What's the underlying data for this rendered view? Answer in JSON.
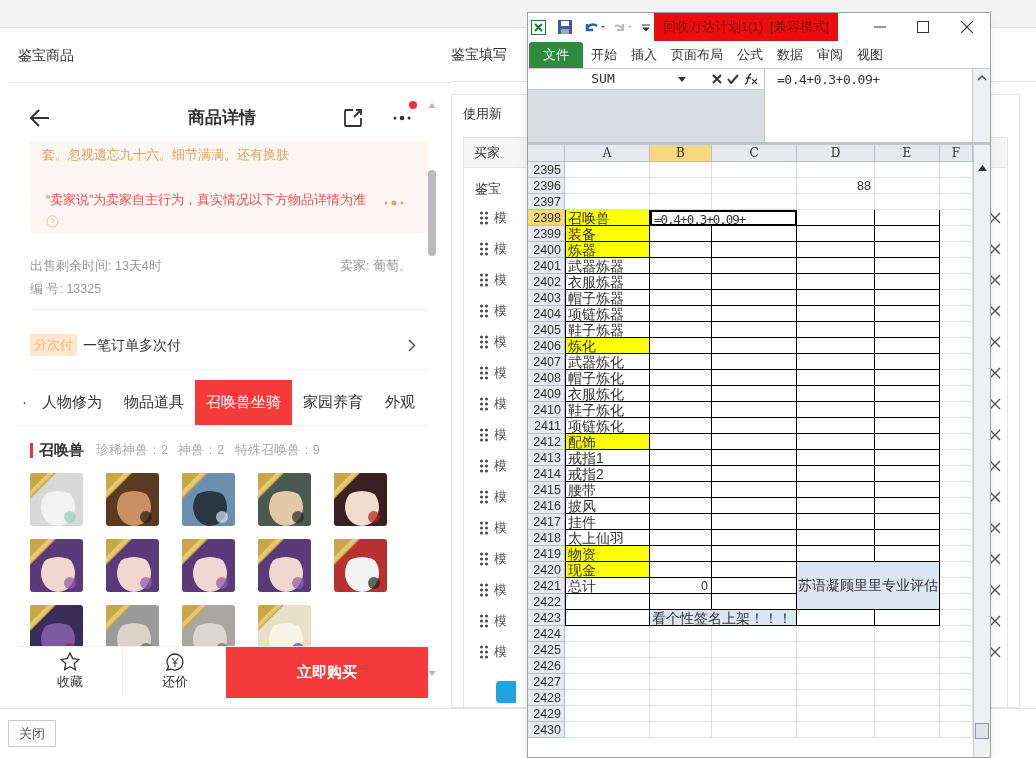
{
  "left_panel": {
    "section_title": "鉴宝商品",
    "phone": {
      "title": "商品详情",
      "has_notification": true,
      "notice": {
        "excerpt": "套。忽视遗忘九十六。细节满满。还有换肤",
        "disclaimer": "“卖家说”为卖家自主行为，真实情况以下方物品详情为准"
      },
      "sale_time": "出售剩余时间: 13天4时",
      "seller": "卖家: 葡萄。",
      "serial": "编 号: 13325",
      "installment": {
        "badge": "分次付",
        "text": "一笔订单多次付"
      },
      "tabs": [
        {
          "label": "·",
          "selected": false
        },
        {
          "label": "人物修为",
          "selected": false
        },
        {
          "label": "物品道具",
          "selected": false
        },
        {
          "label": "召唤兽坐骑",
          "selected": true
        },
        {
          "label": "家园养育",
          "selected": false
        },
        {
          "label": "外观",
          "selected": false
        }
      ],
      "pets": {
        "title": "召唤兽",
        "counts": "珍稀神兽：2   神兽：2   特殊召唤兽：9"
      },
      "actions": [
        {
          "kind": "favorite",
          "label": "收藏"
        },
        {
          "kind": "bargain",
          "label": "还价"
        }
      ],
      "buy_button": "立即购买"
    },
    "close_button": "关闭"
  },
  "right_panel": {
    "title": "鉴宝填写",
    "tab": "使用新",
    "header": "买家",
    "label": "鉴宝",
    "rows": [
      "模",
      "模",
      "模",
      "模",
      "模",
      "模",
      "模",
      "模",
      "模",
      "模",
      "模",
      "模",
      "模",
      "模",
      "模"
    ]
  },
  "excel": {
    "title": "回收万达计划1(1)  [兼容模式]",
    "ribbon_tabs": [
      {
        "label": "文件",
        "selected": true
      },
      {
        "label": "开始",
        "selected": false
      },
      {
        "label": "插入",
        "selected": false
      },
      {
        "label": "页面布局",
        "selected": false
      },
      {
        "label": "公式",
        "selected": false
      },
      {
        "label": "数据",
        "selected": false
      },
      {
        "label": "审阅",
        "selected": false
      },
      {
        "label": "视图",
        "selected": false
      }
    ],
    "name_box": "SUM",
    "formula": "=0.4+0.3+0.09+",
    "columns": [
      {
        "label": "A",
        "selected": false
      },
      {
        "label": "B",
        "selected": true
      },
      {
        "label": "C",
        "selected": false
      },
      {
        "label": "D",
        "selected": false
      },
      {
        "label": "E",
        "selected": false
      },
      {
        "label": "F",
        "selected": false
      }
    ],
    "rows": [
      {
        "number": "2395",
        "selected": false,
        "bordered": false
      },
      {
        "number": "2396",
        "selected": false,
        "bordered": false,
        "d": "88"
      },
      {
        "number": "2397",
        "selected": false,
        "bordered": false
      },
      {
        "number": "2398",
        "selected": true,
        "bordered": true,
        "a": "召唤兽",
        "highlight": true,
        "editing": "=0.4+0.3+0.09+"
      },
      {
        "number": "2399",
        "selected": false,
        "bordered": true,
        "a": "装备",
        "highlight": true
      },
      {
        "number": "2400",
        "selected": false,
        "bordered": true,
        "a": "炼器",
        "highlight": true
      },
      {
        "number": "2401",
        "selected": false,
        "bordered": true,
        "a": "武器炼器",
        "highlight": false
      },
      {
        "number": "2402",
        "selected": false,
        "bordered": true,
        "a": "衣服炼器",
        "highlight": false
      },
      {
        "number": "2403",
        "selected": false,
        "bordered": true,
        "a": "帽子炼器",
        "highlight": false
      },
      {
        "number": "2404",
        "selected": false,
        "bordered": true,
        "a": "项链炼器",
        "highlight": false
      },
      {
        "number": "2405",
        "selected": false,
        "bordered": true,
        "a": "鞋子炼器",
        "highlight": false
      },
      {
        "number": "2406",
        "selected": false,
        "bordered": true,
        "a": "炼化",
        "highlight": true
      },
      {
        "number": "2407",
        "selected": false,
        "bordered": true,
        "a": "武器炼化",
        "highlight": false
      },
      {
        "number": "2408",
        "selected": false,
        "bordered": true,
        "a": "帽子炼化",
        "highlight": false
      },
      {
        "number": "2409",
        "selected": false,
        "bordered": true,
        "a": "衣服炼化",
        "highlight": false
      },
      {
        "number": "2410",
        "selected": false,
        "bordered": true,
        "a": "鞋子炼化",
        "highlight": false
      },
      {
        "number": "2411",
        "selected": false,
        "bordered": true,
        "a": "项链炼化",
        "highlight": false
      },
      {
        "number": "2412",
        "selected": false,
        "bordered": true,
        "a": "配饰",
        "highlight": true
      },
      {
        "number": "2413",
        "selected": false,
        "bordered": true,
        "a": "戒指1",
        "highlight": false
      },
      {
        "number": "2414",
        "selected": false,
        "bordered": true,
        "a": "戒指2",
        "highlight": false
      },
      {
        "number": "2415",
        "selected": false,
        "bordered": true,
        "a": "腰带",
        "highlight": false
      },
      {
        "number": "2416",
        "selected": false,
        "bordered": true,
        "a": "披风",
        "highlight": false
      },
      {
        "number": "2417",
        "selected": false,
        "bordered": true,
        "a": "挂件",
        "highlight": false
      },
      {
        "number": "2418",
        "selected": false,
        "bordered": true,
        "a": "太上仙羽",
        "highlight": false
      },
      {
        "number": "2419",
        "selected": false,
        "bordered": true,
        "a": "物资",
        "highlight": true
      },
      {
        "number": "2420",
        "selected": false,
        "bordered": true,
        "a": "现金",
        "highlight": true,
        "merged_d_e": "苏语凝顾里里专业评估"
      },
      {
        "number": "2421",
        "selected": false,
        "bordered": true,
        "a": "总计",
        "highlight": false,
        "b": "0"
      },
      {
        "number": "2422",
        "selected": false,
        "bordered": true
      },
      {
        "number": "2423",
        "selected": false,
        "bordered": true,
        "merged_b_c": "看个性签名上架！！！"
      },
      {
        "number": "2424",
        "selected": false,
        "bordered": false
      },
      {
        "number": "2425",
        "selected": false,
        "bordered": false
      },
      {
        "number": "2426",
        "selected": false,
        "bordered": false
      },
      {
        "number": "2427",
        "selected": false,
        "bordered": false
      },
      {
        "number": "2428",
        "selected": false,
        "bordered": false
      },
      {
        "number": "2429",
        "selected": false,
        "bordered": false
      },
      {
        "number": "2430",
        "selected": false,
        "bordered": false
      }
    ]
  }
}
